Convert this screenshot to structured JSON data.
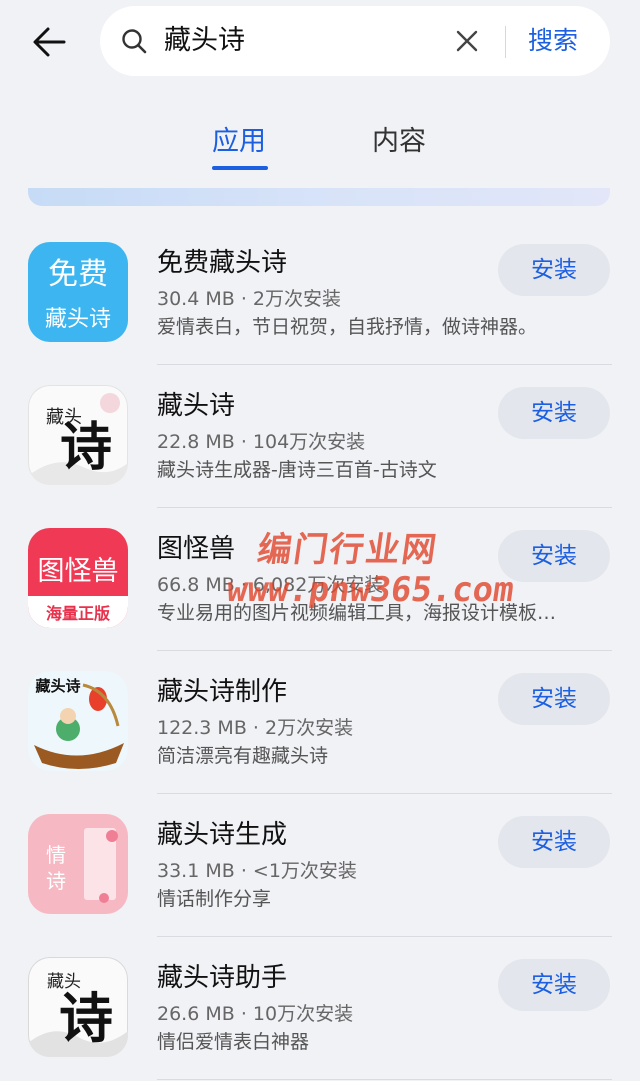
{
  "header": {
    "search_query": "藏头诗",
    "search_button": "搜索"
  },
  "tabs": [
    {
      "label": "应用",
      "active": true
    },
    {
      "label": "内容",
      "active": false
    }
  ],
  "apps": [
    {
      "name": "免费藏头诗",
      "size": "30.4 MB",
      "installs": "2万次安装",
      "desc": "爱情表白，节日祝贺，自我抒情，做诗神器。",
      "button": "安装",
      "icon_text_top": "免费",
      "icon_text_bottom": "藏头诗",
      "icon_color": "#3cb5f0"
    },
    {
      "name": "藏头诗",
      "size": "22.8 MB",
      "installs": "104万次安装",
      "desc": "藏头诗生成器-唐诗三百首-古诗文",
      "button": "安装",
      "icon_text_big": "诗",
      "icon_text_small": "藏头"
    },
    {
      "name": "图怪兽",
      "size": "66.8 MB",
      "installs": "6,082万次安装",
      "desc": "专业易用的图片视频编辑工具，海报设计模板…",
      "button": "安装",
      "icon_text_top": "图怪兽",
      "icon_text_bottom": "海量正版",
      "icon_color": "#f03a55"
    },
    {
      "name": "藏头诗制作",
      "size": "122.3 MB",
      "installs": "2万次安装",
      "desc": "简洁漂亮有趣藏头诗",
      "button": "安装",
      "icon_text_top": "藏头诗"
    },
    {
      "name": "藏头诗生成",
      "size": "33.1 MB",
      "installs": "<1万次安装",
      "desc": "情话制作分享",
      "button": "安装",
      "icon_text_top": "情",
      "icon_text_bottom": "诗",
      "icon_color": "#f3a6b4"
    },
    {
      "name": "藏头诗助手",
      "size": "26.6 MB",
      "installs": "10万次安装",
      "desc": "情侣爱情表白神器",
      "button": "安装",
      "icon_text_big": "诗",
      "icon_text_small": "藏头"
    }
  ],
  "watermark": {
    "line1": "编门行业网",
    "line2": "www.pnw365.com"
  },
  "colors": {
    "accent": "#1c5fe0",
    "background": "#f1f2f6"
  }
}
